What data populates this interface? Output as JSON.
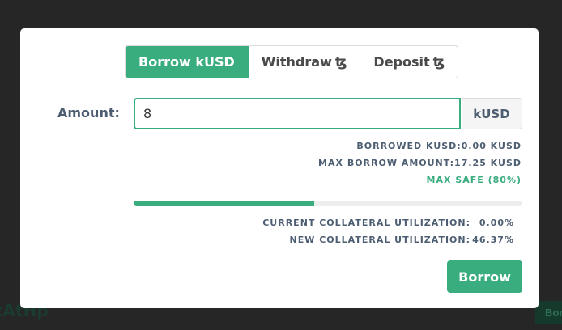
{
  "background": {
    "partial_text": "tAtHp",
    "partial_button": "Bor"
  },
  "tabs": [
    {
      "label": "Borrow kUSD",
      "active": true,
      "icon": ""
    },
    {
      "label": "Withdraw",
      "active": false,
      "icon": "ꜩ"
    },
    {
      "label": "Deposit",
      "active": false,
      "icon": "ꜩ"
    }
  ],
  "amount": {
    "label": "Amount:",
    "value": "8",
    "unit": "kUSD"
  },
  "stats": {
    "borrowed": "BORROWED KUSD:0.00 KUSD",
    "max_borrow": "MAX BORROW AMOUNT:17.25 KUSD",
    "max_safe": "MAX SAFE (80%)"
  },
  "utilization": {
    "progress_percent": 46.37,
    "current_label": "CURRENT COLLATERAL UTILIZATION:",
    "current_value": "0.00%",
    "new_label": "NEW COLLATERAL UTILIZATION:",
    "new_value": "46.37%"
  },
  "borrow_button": "Borrow",
  "colors": {
    "accent": "#3aad7f",
    "text": "#4e5e72",
    "overlay": "#262626"
  }
}
